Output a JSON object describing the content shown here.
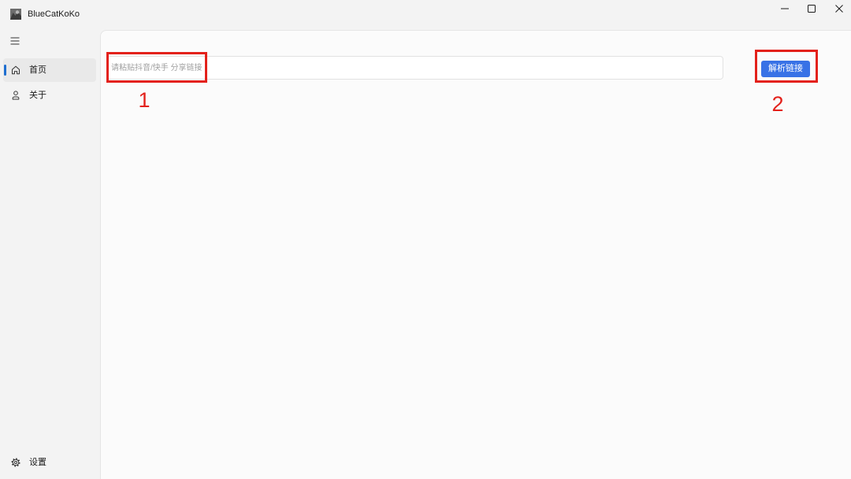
{
  "window": {
    "title": "BlueCatKoKo",
    "app_icon": "app-logo-icon",
    "controls": {
      "minimize_icon": "minimize-icon",
      "maximize_icon": "maximize-icon",
      "close_icon": "close-icon"
    }
  },
  "sidebar": {
    "menu_icon": "hamburger-icon",
    "items": [
      {
        "label": "首页",
        "icon": "home-icon",
        "selected": true
      },
      {
        "label": "关于",
        "icon": "person-icon",
        "selected": false
      }
    ],
    "footer_items": [
      {
        "label": "设置",
        "icon": "gear-icon"
      }
    ]
  },
  "main": {
    "link_input": {
      "value": "",
      "placeholder": "请粘贴抖音/快手 分享链接"
    },
    "parse_button": {
      "label": "解析链接"
    }
  },
  "annotations": [
    {
      "label": "1"
    },
    {
      "label": "2"
    }
  ],
  "colors": {
    "nav_indicator": "#1f6fd0",
    "primary_button": "#3872e6",
    "annotation": "#e3211b"
  }
}
